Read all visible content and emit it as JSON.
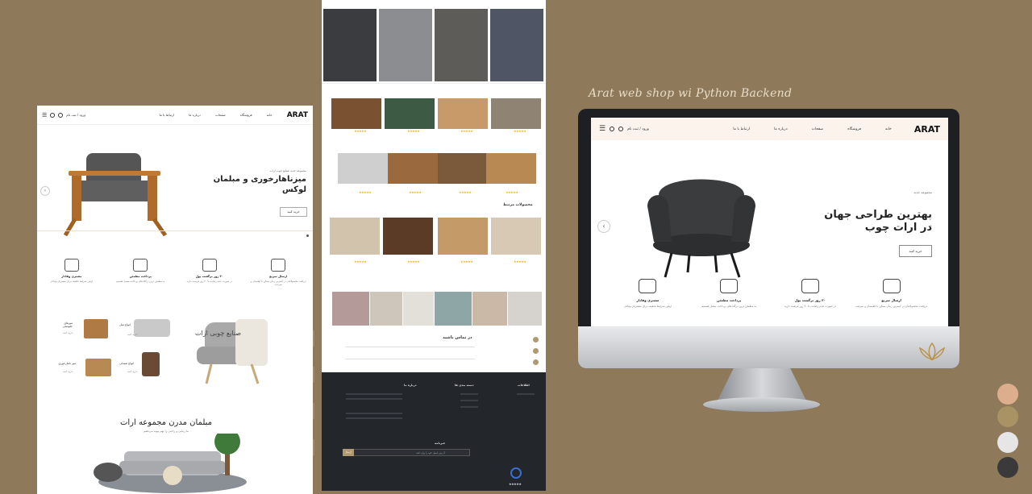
{
  "banner_title": "Arat web shop wi Python Backend",
  "palette": [
    "#dcae8e",
    "#a99263",
    "#e6e6e6",
    "#3a3a3a"
  ],
  "left": {
    "logo": "ARAT",
    "nav": [
      "خانه",
      "فروشگاه",
      "صفحات",
      "درباره ما",
      "ارتباط با ما"
    ],
    "login": "ورود / ثبت نام",
    "hero_sub": "مجموعه جدید صنایع چوب ارات",
    "hero_title": "میزناهارخوری و مبلمان لوکس",
    "hero_button": "خرید کنید",
    "features": [
      {
        "title": "ارسال سریع",
        "desc": "دریافت محصولاتتان در کمترین زمان ممکن با اطمینان و سرعت"
      },
      {
        "title": "۳۰ روز برگشت پول",
        "desc": "در صورت عدم رضایت تا ۳۰ روز فرصت دارید"
      },
      {
        "title": "پرداخت مطمئن",
        "desc": "به مطمئن ترین درگاه های پرداخت متصل هستیم"
      },
      {
        "title": "مشتری وفادار",
        "desc": "اولین شرایط تخفیف برای مشتریان وفادار"
      }
    ],
    "center_title": "صنایع چوبی ارات",
    "categories": [
      "میزهای جلومبلی",
      "انواع مبل",
      "میز ناهارخوری",
      "انواع صندلی"
    ],
    "shop_link": "خرید کنید",
    "bottom_title": "مبلمان مدرن مجموعه ارات",
    "bottom_sub": "ما زیبایی و راحتی را بهم پیوند می‌دهیم"
  },
  "middle": {
    "section_title": "محصولات مرتبط",
    "contact_title": "در تماس باشید",
    "footer": {
      "col1_title": "درباره ما",
      "col2_title": "دسته بندی ها",
      "col3_title": "اطلاعات",
      "newsletter_title": "خبرنامه",
      "subscribe": "ارسال",
      "input_placeholder": "آدرس ایمیل خود را وارد کنید"
    },
    "stars": "★★★★★"
  },
  "monitor": {
    "logo": "ARAT",
    "nav": [
      "خانه",
      "فروشگاه",
      "صفحات",
      "درباره ما",
      "ارتباط با ما"
    ],
    "login": "ورود / ثبت نام",
    "hero_sub": "مجموعه جدید",
    "hero_title": "بهترین طراحی جهان در ارات چوب",
    "hero_button": "خرید کنید",
    "features": [
      {
        "title": "ارسال سریع",
        "desc": "دریافت محصولاتتان در کمترین زمان ممکن با اطمینان و سرعت"
      },
      {
        "title": "۳۰ روز برگشت پول",
        "desc": "در صورت عدم رضایت تا ۳۰ روز فرصت دارید"
      },
      {
        "title": "پرداخت مطمئن",
        "desc": "به مطمئن ترین درگاه های پرداخت متصل هستیم"
      },
      {
        "title": "مشتری وفادار",
        "desc": "اولین شرایط تخفیف برای مشتریان وفادار"
      }
    ]
  }
}
